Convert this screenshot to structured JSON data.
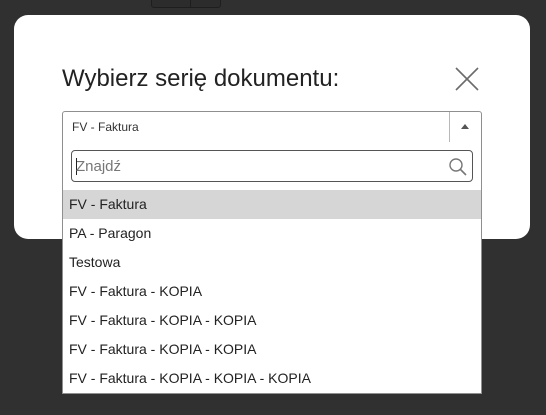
{
  "dialog": {
    "title": "Wybierz serię dokumentu:"
  },
  "icons": {
    "close": "close-icon",
    "search": "search-icon",
    "dropdown_arrow": "caret-up-icon"
  },
  "select": {
    "value": "FV - Faktura"
  },
  "search": {
    "placeholder": "Znajdź",
    "value": ""
  },
  "options": [
    "FV - Faktura",
    "PA - Paragon",
    "Testowa",
    "FV - Faktura - KOPIA",
    "FV - Faktura - KOPIA - KOPIA",
    "FV - Faktura - KOPIA - KOPIA",
    "FV - Faktura - KOPIA - KOPIA - KOPIA"
  ],
  "selected_index": 0,
  "colors": {
    "backdrop": "#303030",
    "dialog": "#ffffff",
    "selected_option": "#d6d6d6"
  }
}
